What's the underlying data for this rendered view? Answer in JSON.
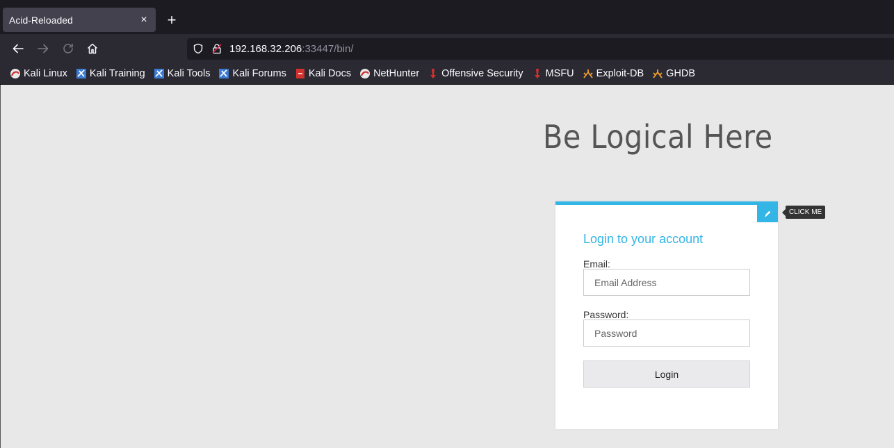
{
  "browser": {
    "tab_title": "Acid-Reloaded",
    "tab_close": "×",
    "new_tab": "+",
    "url_host": "192.168.32.206",
    "url_rest": ":33447/bin/"
  },
  "bookmarks": [
    {
      "label": "Kali Linux",
      "icon": "kali-dragon-icon"
    },
    {
      "label": "Kali Training",
      "icon": "kali-training-icon"
    },
    {
      "label": "Kali Tools",
      "icon": "kali-tools-icon"
    },
    {
      "label": "Kali Forums",
      "icon": "kali-forums-icon"
    },
    {
      "label": "Kali Docs",
      "icon": "kali-docs-icon"
    },
    {
      "label": "NetHunter",
      "icon": "nethunter-icon"
    },
    {
      "label": "Offensive Security",
      "icon": "offsec-icon"
    },
    {
      "label": "MSFU",
      "icon": "msfu-icon"
    },
    {
      "label": "Exploit-DB",
      "icon": "exploit-db-icon"
    },
    {
      "label": "GHDB",
      "icon": "ghdb-icon"
    }
  ],
  "page": {
    "headline": "Be Logical Here",
    "tooltip": "CLICK ME",
    "login": {
      "title": "Login to your account",
      "email_label": "Email:",
      "email_placeholder": "Email Address",
      "password_label": "Password:",
      "password_placeholder": "Password",
      "button": "Login"
    }
  },
  "colors": {
    "accent": "#33b5e5",
    "page_bg": "#e8e8e8",
    "chrome_dark": "#1c1b22",
    "chrome": "#2b2a33"
  }
}
